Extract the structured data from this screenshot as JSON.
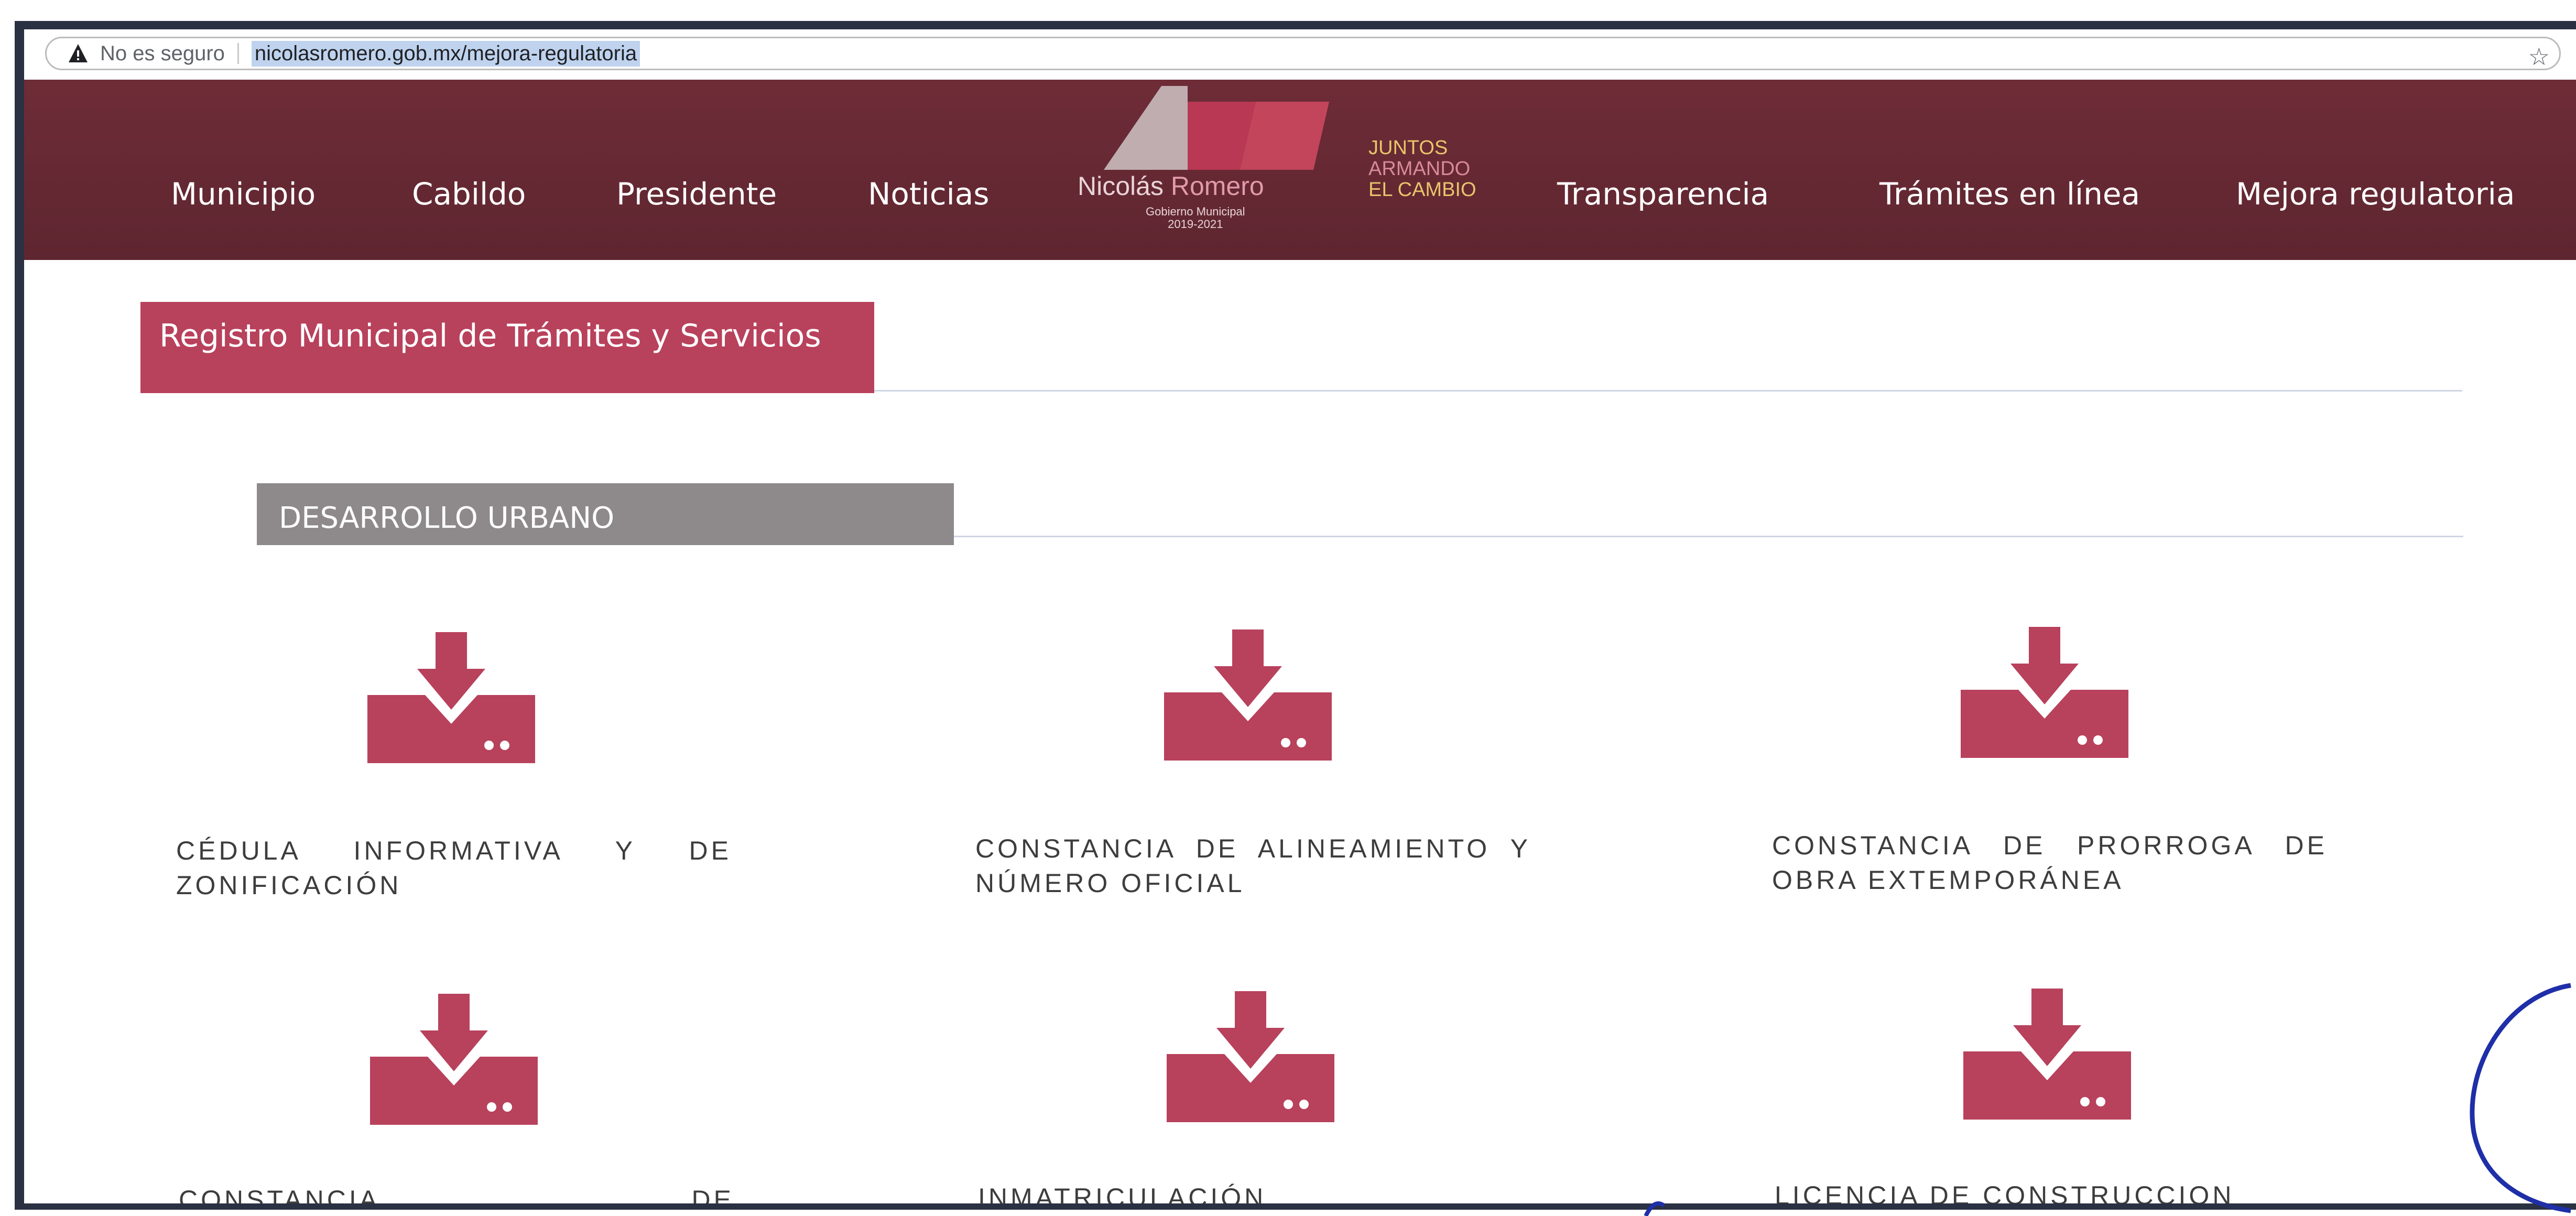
{
  "browser": {
    "security_text": "No es seguro",
    "url": "nicolasromero.gob.mx/mejora-regulatoria",
    "icons": [
      "warning-icon",
      "star-icon"
    ]
  },
  "nav": {
    "items": [
      "Municipio",
      "Cabildo",
      "Presidente",
      "Noticias",
      "Transparencia",
      "Trámites en línea",
      "Mejora regulatoria"
    ]
  },
  "logo": {
    "name_part1": "Nicolás",
    "name_part2": "Romero",
    "sub_line1": "Gobierno Municipal",
    "sub_line2": "2019-2021",
    "slogan_line1": "JUNTOS",
    "slogan_line2": "ARMANDO",
    "slogan_line3": "EL CAMBIO"
  },
  "page": {
    "section_title": "Registro Municipal de Trámites y Servicios",
    "category_title": "DESARROLLO URBANO",
    "items": [
      {
        "label": "CÉDULA INFORMATIVA Y DE ZONIFICACIÓN",
        "icon": "download-icon"
      },
      {
        "label": "CONSTANCIA DE ALINEAMIENTO Y NÚMERO OFICIAL",
        "icon": "download-icon"
      },
      {
        "label": "CONSTANCIA DE PRORROGA DE OBRA EXTEMPORÁNEA",
        "icon": "download-icon"
      },
      {
        "label": "CONSTANCIA DE",
        "icon": "download-icon"
      },
      {
        "label": "INMATRICULACIÓN",
        "icon": "download-icon"
      },
      {
        "label": "LICENCIA DE CONSTRUCCION",
        "icon": "download-icon"
      }
    ]
  },
  "colors": {
    "header": "#6e2c37",
    "accent": "#b8415c",
    "category": "#8e8a8b",
    "frame": "#2a3142"
  }
}
